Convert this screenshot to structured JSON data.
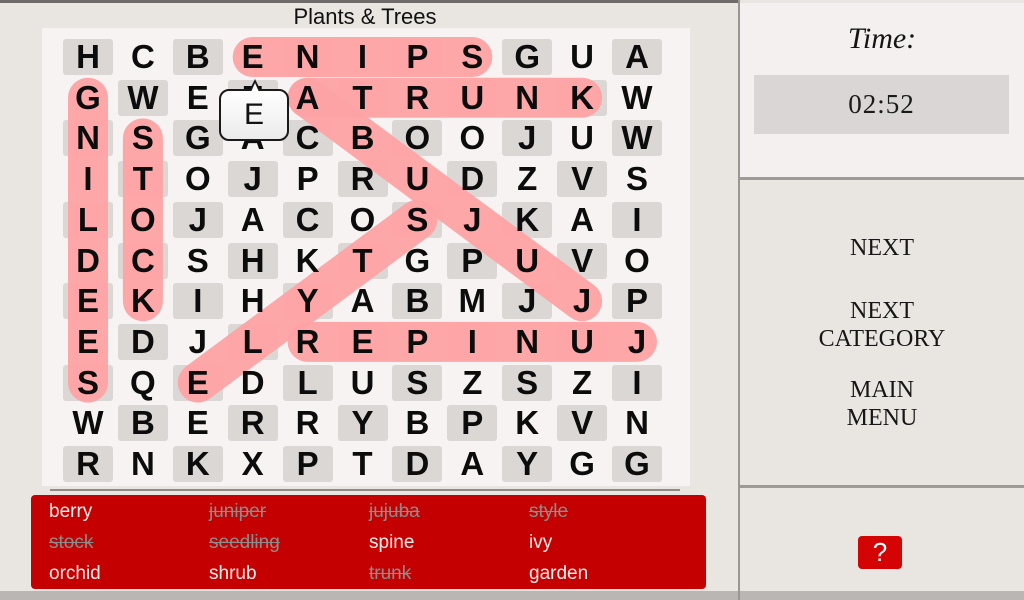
{
  "header": {
    "category_title": "Plants & Trees"
  },
  "grid": {
    "rows": [
      [
        "H",
        "C",
        "B",
        "E",
        "N",
        "I",
        "P",
        "S",
        "G",
        "U",
        "A"
      ],
      [
        "G",
        "W",
        "E",
        "E",
        "A",
        "T",
        "R",
        "U",
        "N",
        "K",
        "W"
      ],
      [
        "N",
        "S",
        "G",
        "A",
        "C",
        "B",
        "O",
        "O",
        "J",
        "U",
        "W"
      ],
      [
        "I",
        "T",
        "O",
        "J",
        "P",
        "R",
        "U",
        "D",
        "Z",
        "V",
        "S"
      ],
      [
        "L",
        "O",
        "J",
        "A",
        "C",
        "O",
        "S",
        "J",
        "K",
        "A",
        "I"
      ],
      [
        "D",
        "C",
        "S",
        "H",
        "K",
        "T",
        "G",
        "P",
        "U",
        "V",
        "O"
      ],
      [
        "E",
        "K",
        "I",
        "H",
        "Y",
        "A",
        "B",
        "M",
        "J",
        "J",
        "P"
      ],
      [
        "E",
        "D",
        "J",
        "L",
        "R",
        "E",
        "P",
        "I",
        "N",
        "U",
        "J"
      ],
      [
        "S",
        "Q",
        "E",
        "D",
        "L",
        "U",
        "S",
        "Z",
        "S",
        "Z",
        "I"
      ],
      [
        "W",
        "B",
        "E",
        "R",
        "R",
        "Y",
        "B",
        "P",
        "K",
        "V",
        "N"
      ],
      [
        "R",
        "N",
        "K",
        "X",
        "P",
        "T",
        "D",
        "A",
        "Y",
        "G",
        "G"
      ]
    ],
    "selection_popup_letter": "E",
    "highlights": [
      {
        "word": "spine",
        "from": [
          0,
          7
        ],
        "to": [
          0,
          3
        ]
      },
      {
        "word": "trunk",
        "from": [
          1,
          4
        ],
        "to": [
          1,
          9
        ]
      },
      {
        "word": "seedling",
        "from": [
          8,
          0
        ],
        "to": [
          1,
          0
        ]
      },
      {
        "word": "stock",
        "from": [
          2,
          1
        ],
        "to": [
          6,
          1
        ]
      },
      {
        "word": "juniper",
        "from": [
          7,
          10
        ],
        "to": [
          7,
          4
        ]
      },
      {
        "word": "jujuba",
        "from": [
          6,
          9
        ],
        "to": [
          1,
          4
        ]
      },
      {
        "word": "style",
        "from": [
          4,
          6
        ],
        "to": [
          8,
          2
        ]
      }
    ],
    "highlight_color": "#ffa3a5"
  },
  "word_list": {
    "columns": [
      [
        {
          "text": "berry",
          "found": false
        },
        {
          "text": "stock",
          "found": true
        },
        {
          "text": "orchid",
          "found": false
        }
      ],
      [
        {
          "text": "juniper",
          "found": true
        },
        {
          "text": "seedling",
          "found": true
        },
        {
          "text": "shrub",
          "found": false
        }
      ],
      [
        {
          "text": "jujuba",
          "found": true
        },
        {
          "text": "spine",
          "found": false
        },
        {
          "text": "trunk",
          "found": true
        }
      ],
      [
        {
          "text": "style",
          "found": true
        },
        {
          "text": "ivy",
          "found": false
        },
        {
          "text": "garden",
          "found": false
        }
      ]
    ],
    "background_color": "#c40000"
  },
  "side_panel": {
    "time_label": "Time:",
    "time_value": "02:52",
    "next_label": "NEXT",
    "next_category_line1": "NEXT",
    "next_category_line2": "CATEGORY",
    "main_menu_line1": "MAIN",
    "main_menu_line2": "MENU",
    "help_icon": "question-mark-icon",
    "help_glyph": "?",
    "help_color": "#d40404"
  }
}
